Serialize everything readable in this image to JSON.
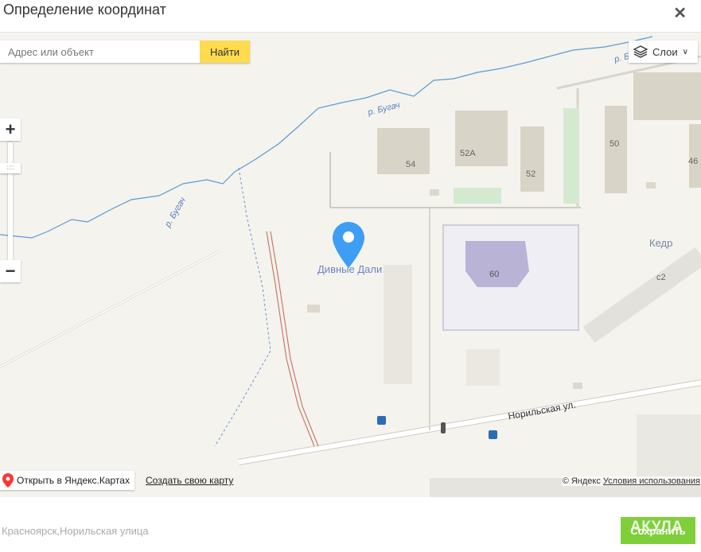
{
  "dialog": {
    "title": "Определение координат",
    "close_icon": "close-icon"
  },
  "search": {
    "placeholder": "Адрес или объект",
    "button_label": "Найти"
  },
  "layers": {
    "label": "Слои",
    "icon": "layers-icon"
  },
  "zoom": {
    "plus": "+",
    "minus": "−",
    "handle": "::::"
  },
  "map": {
    "marker_label": "Дивные Дали",
    "labels": {
      "river1": "р. Бугач",
      "river2": "р. Бугач",
      "river3": "р. Б",
      "b54": "54",
      "b52a": "52А",
      "b52": "52",
      "b50": "50",
      "b46": "46",
      "b60": "60",
      "kedr": "Кедр",
      "c2": "с2",
      "street": "Норильская ул."
    }
  },
  "footer_links": {
    "open_yandex": "Открыть в Яндекс.Картах",
    "create_map": "Создать свою карту",
    "copyright": "© Яндекс",
    "terms": "Условия использования"
  },
  "address_value": "Красноярск,Норильская улица",
  "save_label": "Сохранить",
  "watermark": "АКУЛА",
  "colors": {
    "accent_yellow": "#ffdb4d",
    "save_green": "#7fcf3a",
    "marker_blue": "#3d9ef4",
    "river_blue": "#5b9bd5"
  }
}
